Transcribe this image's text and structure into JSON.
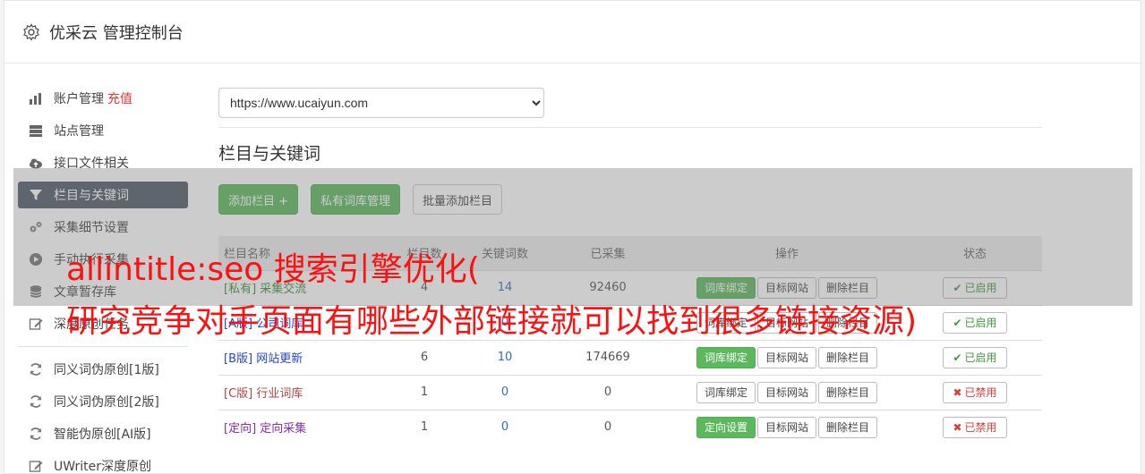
{
  "app": {
    "title": "优采云 管理控制台"
  },
  "sidebar": {
    "items": [
      {
        "label": "账户管理",
        "extra": "充值",
        "icon": "bar-chart-icon"
      },
      {
        "label": "站点管理",
        "icon": "server-icon"
      },
      {
        "label": "接口文件相关",
        "icon": "cloud-upload-icon"
      },
      {
        "label": "栏目与关键词",
        "icon": "filter-icon",
        "active": true
      },
      {
        "label": "采集细节设置",
        "icon": "cogs-icon"
      },
      {
        "label": "手动执行采集",
        "icon": "play-circle-icon"
      },
      {
        "label": "文章暂存库",
        "icon": "database-icon"
      },
      {
        "label": "深度原创任务",
        "icon": "edit-icon"
      }
    ],
    "tools": [
      {
        "label": "同义词伪原创[1版]",
        "icon": "refresh-icon"
      },
      {
        "label": "同义词伪原创[2版]",
        "icon": "refresh-icon"
      },
      {
        "label": "智能伪原创[AI版]",
        "icon": "refresh-icon"
      },
      {
        "label": "UWriter深度原创",
        "icon": "edit-icon"
      }
    ]
  },
  "main": {
    "site_select": {
      "value": "https://www.ucaiyun.com"
    },
    "section_title": "栏目与关键词",
    "toolbar": {
      "add_column": "添加栏目 +",
      "private_lexicon": "私有词库管理",
      "batch_add": "批量添加栏目"
    },
    "table": {
      "headers": [
        "栏目名称",
        "栏目数",
        "关键词数",
        "已采集",
        "操作",
        "状态"
      ],
      "rows": [
        {
          "tag": "[私有]",
          "name": "采集交流",
          "color": "#3c8a3c",
          "a": "4",
          "b": "14",
          "collected": "92460",
          "op1": "词库绑定",
          "op1_green": true,
          "op2": "目标网站",
          "op3": "删除栏目",
          "status": "已启用",
          "on": true
        },
        {
          "tag": "[A版]",
          "name": "公司词库",
          "color": "#2145c9",
          "a": "",
          "b": "0",
          "collected": "",
          "op1": "词库绑定",
          "op1_green": false,
          "op2": "目标网站",
          "op3": "删除栏目",
          "status": "已启用",
          "on": true
        },
        {
          "tag": "[B版]",
          "name": "网站更新",
          "color": "#2145c9",
          "a": "6",
          "b": "10",
          "collected": "174669",
          "op1": "词库绑定",
          "op1_green": true,
          "op2": "目标网站",
          "op3": "删除栏目",
          "status": "已启用",
          "on": true
        },
        {
          "tag": "[C版]",
          "name": "行业词库",
          "color": "#b44444",
          "a": "1",
          "b": "0",
          "collected": "0",
          "op1": "词库绑定",
          "op1_green": false,
          "op2": "目标网站",
          "op3": "删除栏目",
          "status": "已禁用",
          "on": false
        },
        {
          "tag": "[定向]",
          "name": "定向采集",
          "color": "#8b2bb3",
          "a": "1",
          "b": "0",
          "collected": "0",
          "op1": "定向设置",
          "op1_green": true,
          "op2": "目标网站",
          "op3": "删除栏目",
          "status": "已禁用",
          "on": false
        }
      ]
    }
  },
  "overlay": {
    "line1": "allintitle:seo 搜索引擎优化(",
    "line2": "研究竞争对手页面有哪些外部链接就可以找到很多链接资源)"
  },
  "colors": {
    "accent_green": "#5cb85c",
    "active_nav": "#505a67",
    "overlay_text": "#ff1010",
    "recharge": "#ee3333"
  }
}
